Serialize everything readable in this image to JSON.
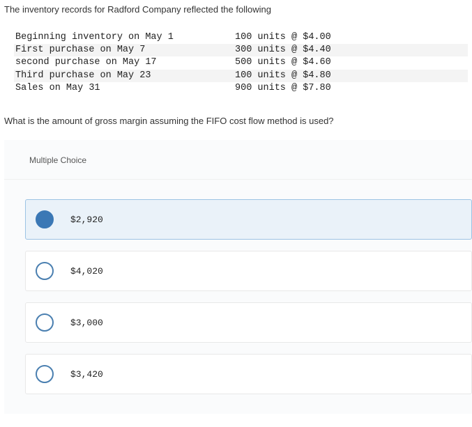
{
  "question": {
    "intro": "The inventory records for Radford Company reflected the following",
    "rows": [
      {
        "desc": "Beginning inventory on May 1",
        "value": "100 units @ $4.00",
        "shaded": false
      },
      {
        "desc": "First purchase on May 7",
        "value": "300 units @ $4.40",
        "shaded": true
      },
      {
        "desc": "second purchase on May 17",
        "value": "500 units @ $4.60",
        "shaded": false
      },
      {
        "desc": "Third purchase on May 23",
        "value": "100 units @ $4.80",
        "shaded": true
      },
      {
        "desc": "Sales on May 31",
        "value": "900 units @ $7.80",
        "shaded": false
      }
    ],
    "followup": "What is the amount of gross margin assuming the FIFO cost flow method is used?"
  },
  "mc": {
    "header": "Multiple Choice",
    "options": [
      {
        "label": "$2,920",
        "selected": true
      },
      {
        "label": "$4,020",
        "selected": false
      },
      {
        "label": "$3,000",
        "selected": false
      },
      {
        "label": "$3,420",
        "selected": false
      }
    ]
  }
}
